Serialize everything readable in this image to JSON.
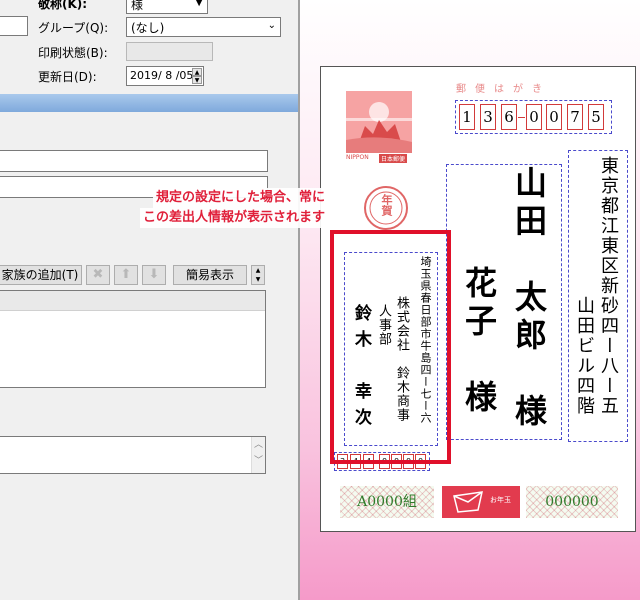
{
  "form": {
    "title_label": "敬称(K):",
    "title_value": "様",
    "group_label": "グループ(Q):",
    "group_value": "(なし)",
    "print_status_label": "印刷状態(B):",
    "updated_label": "更新日(D):",
    "updated_value": "2019/ 8 /05"
  },
  "toolbar": {
    "add_family_label": "家族の追加(T)",
    "simple_view_label": "簡易表示"
  },
  "postcard": {
    "header_text": "郵便はがき",
    "stamp_caption": "NIPPON",
    "stamp_right_caption": "日本郵便",
    "new_year_mark": "年賀",
    "postal_code": [
      "1",
      "3",
      "6",
      "0",
      "0",
      "7",
      "5"
    ],
    "recipient_address": [
      "東京都江東区新砂四ー八ー五",
      "山田ビル四階"
    ],
    "recipient_names": [
      "山田　太郎　様",
      "花子　様"
    ],
    "sender_address": "埼玉県春日部市牛島四ー七ー六",
    "sender_company": "株式会社　鈴木商事",
    "sender_dept": "人事部",
    "sender_name": "鈴木　幸次",
    "sender_postal": [
      "3",
      "4",
      "4",
      "0",
      "0",
      "0",
      "0"
    ],
    "lottery_left": "A0000組",
    "lottery_right": "000000",
    "otoshidama_label": "お年玉"
  },
  "callout": {
    "line1": "規定の設定にした場合、常に",
    "line2": "この差出人情報が表示されます"
  },
  "colors": {
    "accent_red": "#e0102a",
    "postcode_red": "#d23a3a",
    "lottery_green": "#2f7a2a",
    "guide_blue": "#4a4acc"
  }
}
